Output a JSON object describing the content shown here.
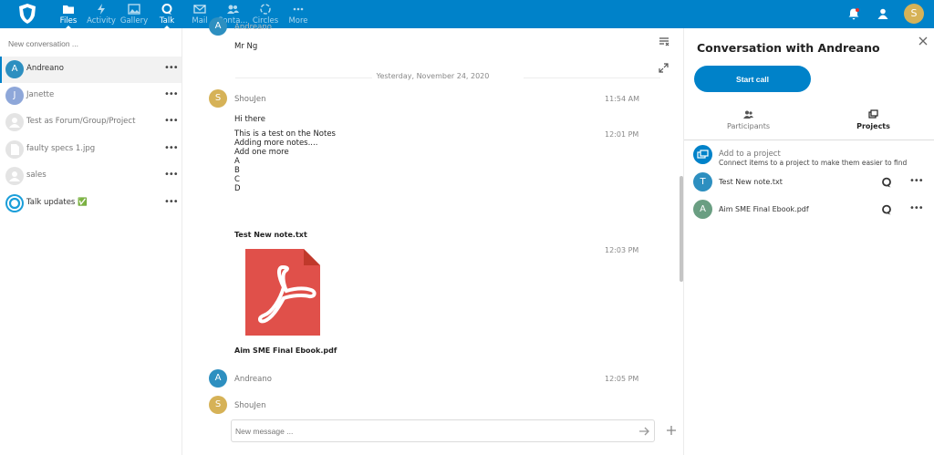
{
  "colors": {
    "brand": "#0082c9",
    "avatar_a": "#2d8fc0",
    "avatar_j": "#8ea7d9",
    "avatar_s": "#d6b257",
    "avatar_pdf": "#6a9e82",
    "pdf_red": "#e0504a"
  },
  "topbar": {
    "apps": [
      {
        "label": "Files",
        "icon": "folder-icon",
        "active": true
      },
      {
        "label": "Activity",
        "icon": "activity-icon",
        "active": false
      },
      {
        "label": "Gallery",
        "icon": "image-icon",
        "active": false
      },
      {
        "label": "Talk",
        "icon": "talk-icon",
        "active": true
      },
      {
        "label": "Mail",
        "icon": "mail-icon",
        "active": false
      },
      {
        "label": "Conta...",
        "icon": "contacts-icon",
        "active": false
      },
      {
        "label": "Circles",
        "icon": "circles-icon",
        "active": false
      },
      {
        "label": "More",
        "icon": "more-icon",
        "active": false
      }
    ],
    "user_initial": "S"
  },
  "left": {
    "new_conversation_placeholder": "New conversation ...",
    "conversations": [
      {
        "name": "Andreano",
        "initial": "A",
        "selected": true
      },
      {
        "name": "Janette",
        "initial": "J",
        "selected": false
      },
      {
        "name": "Test as Forum/Group/Project",
        "initial": "",
        "selected": false
      },
      {
        "name": "faulty specs 1.jpg",
        "initial": "",
        "selected": false
      },
      {
        "name": "sales",
        "initial": "",
        "selected": false
      },
      {
        "name": "Talk updates ✅",
        "initial": "",
        "selected": false
      }
    ]
  },
  "chat": {
    "top_cut_name": "Andreano",
    "top_message": "Mr Ng",
    "date_separator": "Yesterday, November 24, 2020",
    "shoujen_name": "ShouJen",
    "shoujen_initial": "S",
    "time_1154": "11:54 AM",
    "msg_hi": "Hi there",
    "msg_notes": "This is a test on the Notes\nAdding more notes....\nAdd one more\nA\nB\nC\nD",
    "time_1201": "12:01 PM",
    "file_note": "Test New note.txt",
    "time_1203": "12:03 PM",
    "file_pdf": "Aim SME Final Ebook.pdf",
    "andreano_name": "Andreano",
    "andreano_initial": "A",
    "time_1205": "12:05 PM",
    "shoujen_name2": "ShouJen",
    "composer_placeholder": "New message ..."
  },
  "sidebar": {
    "title": "Conversation with Andreano",
    "start_call": "Start call",
    "tabs": [
      {
        "label": "Participants",
        "active": false
      },
      {
        "label": "Projects",
        "active": true
      }
    ],
    "add_project_title": "Add to a project",
    "add_project_subtitle": "Connect items to a project to make them easier to find",
    "projects": [
      {
        "name": "Test New note.txt",
        "initial": "T"
      },
      {
        "name": "Aim SME Final Ebook.pdf",
        "initial": "A"
      }
    ]
  }
}
